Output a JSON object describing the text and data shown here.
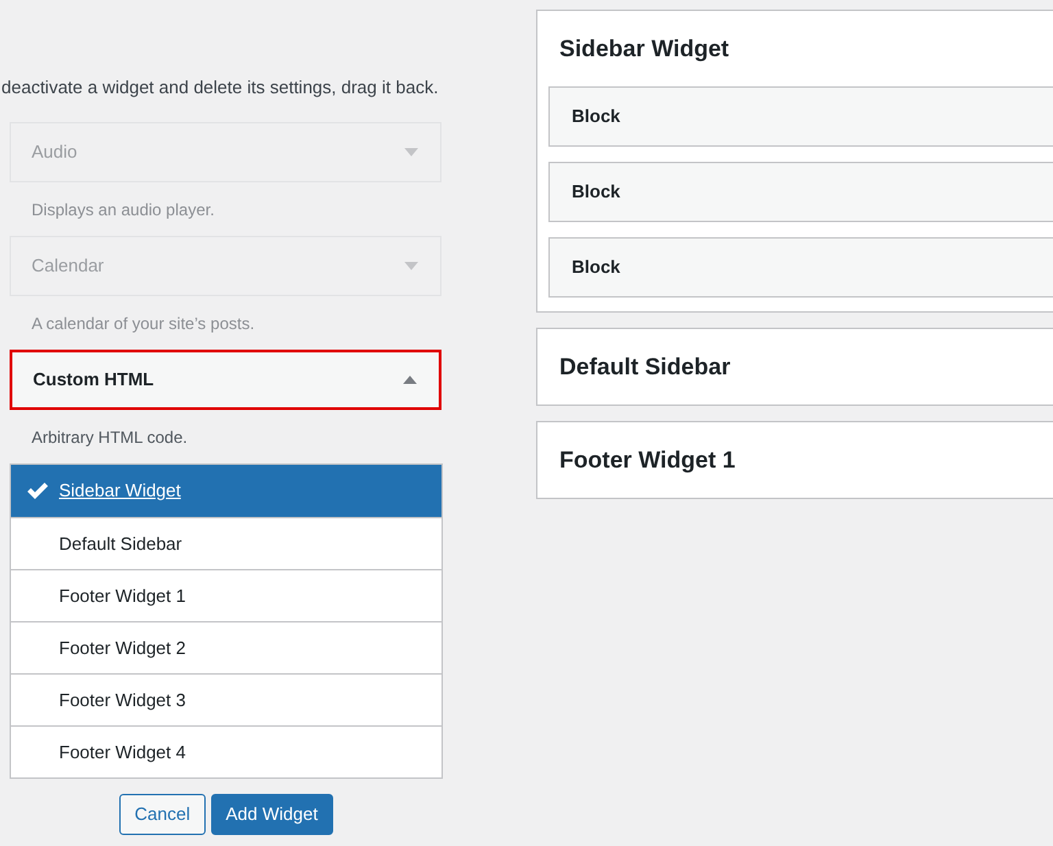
{
  "intro": "deactivate a widget and delete its settings, drag it back.",
  "widgets": [
    {
      "title": "Audio",
      "description": "Displays an audio player.",
      "dimmed": true,
      "expanded": false,
      "highlighted": false
    },
    {
      "title": "Calendar",
      "description": "A calendar of your site’s posts.",
      "dimmed": true,
      "expanded": false,
      "highlighted": false
    },
    {
      "title": "Custom HTML",
      "description": "Arbitrary HTML code.",
      "dimmed": false,
      "expanded": true,
      "highlighted": true
    }
  ],
  "sidebar_chooser": {
    "options": [
      {
        "label": "Sidebar Widget",
        "selected": true
      },
      {
        "label": "Default Sidebar",
        "selected": false
      },
      {
        "label": "Footer Widget 1",
        "selected": false
      },
      {
        "label": "Footer Widget 2",
        "selected": false
      },
      {
        "label": "Footer Widget 3",
        "selected": false
      },
      {
        "label": "Footer Widget 4",
        "selected": false
      }
    ],
    "buttons": [
      {
        "label": "Cancel",
        "kind": "secondary"
      },
      {
        "label": "Add Widget",
        "kind": "primary"
      }
    ]
  },
  "sidebars": [
    {
      "title": "Sidebar Widget",
      "blocks": [
        {
          "label": "Block"
        },
        {
          "label": "Block"
        },
        {
          "label": "Block"
        }
      ]
    },
    {
      "title": "Default Sidebar"
    },
    {
      "title": "Footer Widget 1"
    }
  ]
}
